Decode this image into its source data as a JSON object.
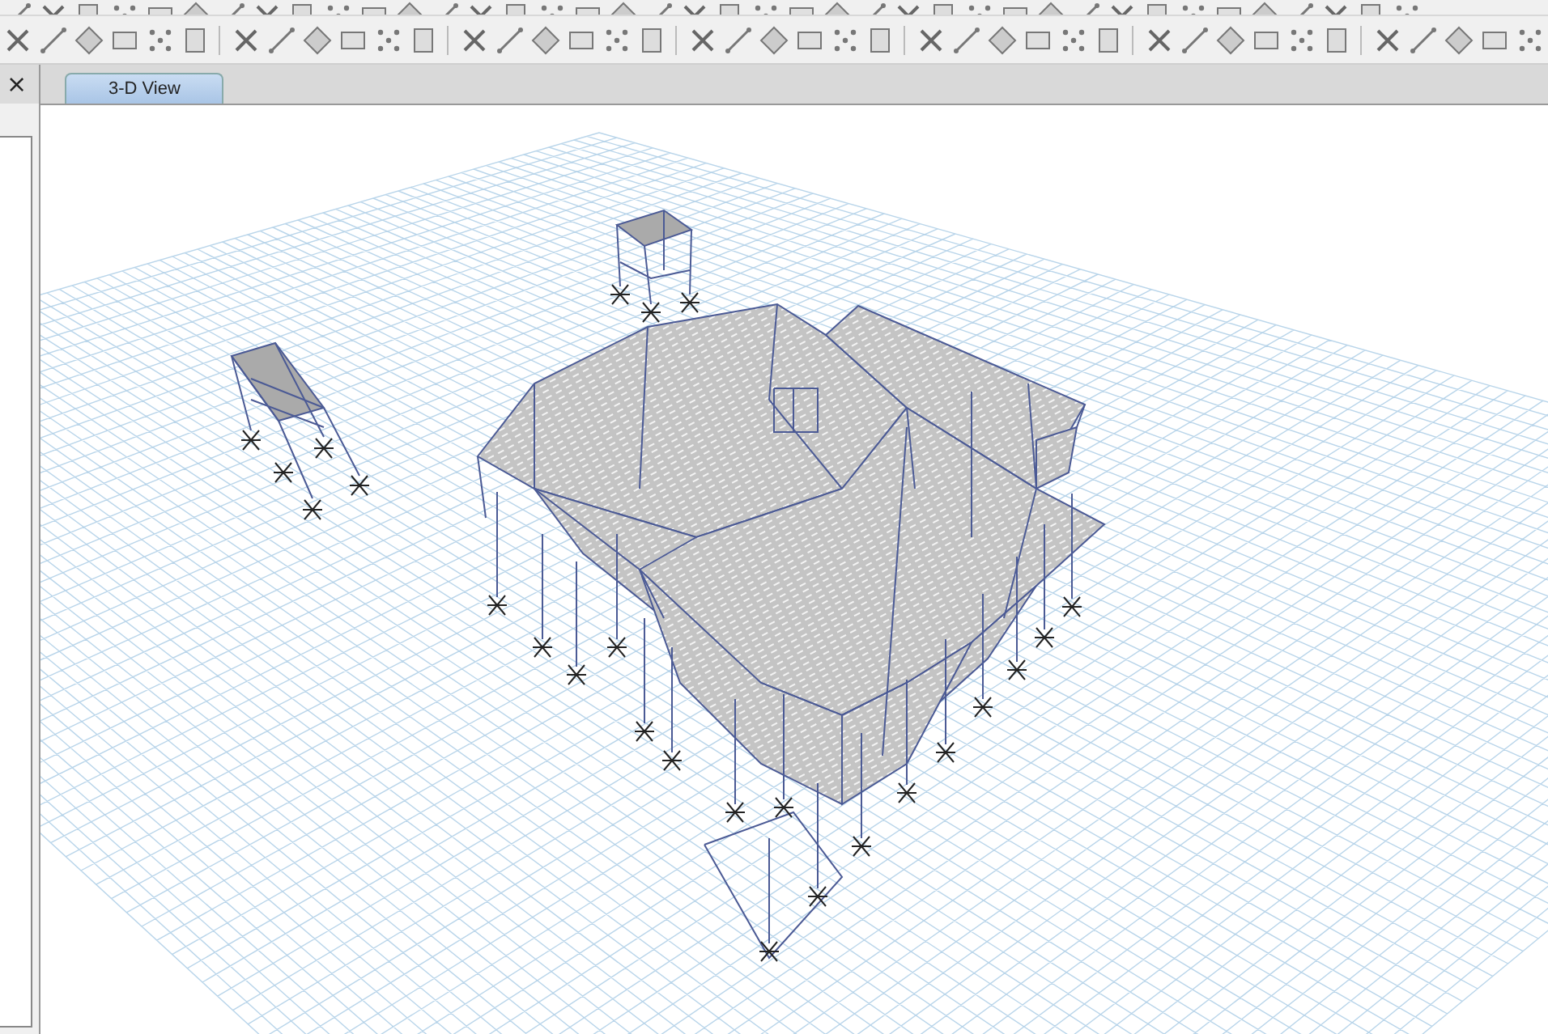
{
  "side_panel": {
    "close": "×"
  },
  "tabs": [
    {
      "label": "3-D View",
      "selected": true
    }
  ]
}
